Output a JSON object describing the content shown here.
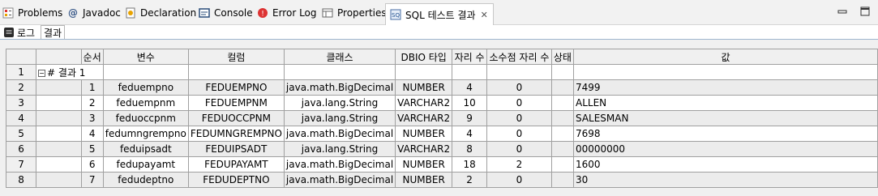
{
  "tabs": [
    {
      "label": "Problems",
      "icon": "problems-icon"
    },
    {
      "label": "Javadoc",
      "icon": "at-icon"
    },
    {
      "label": "Declaration",
      "icon": "declaration-icon"
    },
    {
      "label": "Console",
      "icon": "console-icon"
    },
    {
      "label": "Error Log",
      "icon": "error-log-icon"
    },
    {
      "label": "Properties",
      "icon": "properties-icon"
    },
    {
      "label": "SQL 테스트 결과",
      "icon": "sql-icon",
      "active": true
    }
  ],
  "subtabs": [
    {
      "label": "로그"
    },
    {
      "label": "결과",
      "active": true
    }
  ],
  "table": {
    "headers": [
      "순서",
      "변수",
      "컬럼",
      "클래스",
      "DBIO 타입",
      "자리 수",
      "소수점 자리 수",
      "상태",
      "값"
    ],
    "group_label": "# 결과 1",
    "row_numbers": [
      "1",
      "2",
      "3",
      "4",
      "5",
      "6",
      "7",
      "8"
    ],
    "rows": [
      [
        "1",
        "feduempno",
        "FEDUEMPNO",
        "java.math.BigDecimal",
        "NUMBER",
        "4",
        "0",
        "",
        "7499"
      ],
      [
        "2",
        "feduempnm",
        "FEDUEMPNM",
        "java.lang.String",
        "VARCHAR2",
        "10",
        "0",
        "",
        "ALLEN"
      ],
      [
        "3",
        "feduoccpnm",
        "FEDUOCCPNM",
        "java.lang.String",
        "VARCHAR2",
        "9",
        "0",
        "",
        "SALESMAN"
      ],
      [
        "4",
        "fedumngrempno",
        "FEDUMNGREMPNO",
        "java.math.BigDecimal",
        "NUMBER",
        "4",
        "0",
        "",
        "7698"
      ],
      [
        "5",
        "feduipsadt",
        "FEDUIPSADT",
        "java.lang.String",
        "VARCHAR2",
        "8",
        "0",
        "",
        "00000000"
      ],
      [
        "6",
        "fedupayamt",
        "FEDUPAYAMT",
        "java.math.BigDecimal",
        "NUMBER",
        "18",
        "2",
        "",
        "1600"
      ],
      [
        "7",
        "fedudeptno",
        "FEDUDEPTNO",
        "java.math.BigDecimal",
        "NUMBER",
        "2",
        "0",
        "",
        "30"
      ]
    ]
  }
}
